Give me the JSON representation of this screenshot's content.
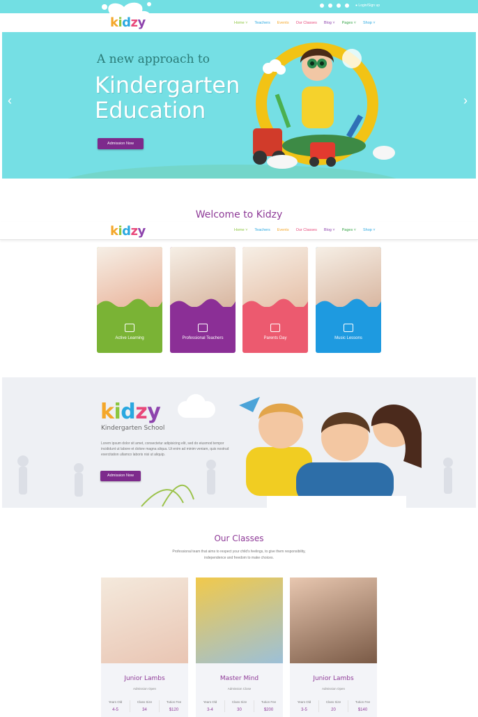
{
  "topbar": {
    "login": "Login/Sign up"
  },
  "logo": {
    "k": "k",
    "i": "i",
    "d": "d",
    "z": "z",
    "y": "y"
  },
  "nav": {
    "items": [
      {
        "label": "Home",
        "color": "#8cc63f",
        "dd": true
      },
      {
        "label": "Teachers",
        "color": "#2aa8e0",
        "dd": false
      },
      {
        "label": "Events",
        "color": "#f4a72a",
        "dd": false
      },
      {
        "label": "Our Classes",
        "color": "#e8487a",
        "dd": false
      },
      {
        "label": "Blog",
        "color": "#8e44ad",
        "dd": true
      },
      {
        "label": "Pages",
        "color": "#3aa64a",
        "dd": true
      },
      {
        "label": "Shop",
        "color": "#2aa8e0",
        "dd": true
      }
    ]
  },
  "hero": {
    "subtitle": "A new approach to",
    "title_line1": "Kindergarten",
    "title_line2": "Education",
    "button": "Admission Now"
  },
  "welcome": {
    "title": "Welcome to Kidzy"
  },
  "features": [
    {
      "label": "Active Learning",
      "color": "#7ab335"
    },
    {
      "label": "Professional Teachers",
      "color": "#8b2f96"
    },
    {
      "label": "Parents Day",
      "color": "#ec5a6f"
    },
    {
      "label": "Music Lessons",
      "color": "#1e9ae0"
    }
  ],
  "about": {
    "subtitle": "Kindergarten School",
    "text": "Lorem ipsum dolor sit amet, consectetur adipisicing elit, sed do eiusmod tempor incididunt ut labore et dolore magna aliqua. Ut enim ad minim veniam, quis nostrud exercitation ullamco laboris nisi ut aliquip.",
    "button": "Admission Now"
  },
  "classes": {
    "title": "Our Classes",
    "intro_line1": "Professional team that aims to respect your child's feelings, to give them responsibility,",
    "intro_line2": "independence and freedom to make choices.",
    "items": [
      {
        "name": "Junior Lambs",
        "status": "Admission Open",
        "h1": "Years Old",
        "h2": "Class Size",
        "h3": "Tution Fee",
        "v1": "4-5",
        "v2": "34",
        "v3": "$120"
      },
      {
        "name": "Master Mind",
        "status": "Admission Close",
        "h1": "Years Old",
        "h2": "Class Size",
        "h3": "Tution Fee",
        "v1": "3-4",
        "v2": "30",
        "v3": "$200"
      },
      {
        "name": "Junior Lambs",
        "status": "Admission Open",
        "h1": "Years Old",
        "h2": "Class Size",
        "h3": "Tution Fee",
        "v1": "3-5",
        "v2": "20",
        "v3": "$140"
      }
    ]
  }
}
